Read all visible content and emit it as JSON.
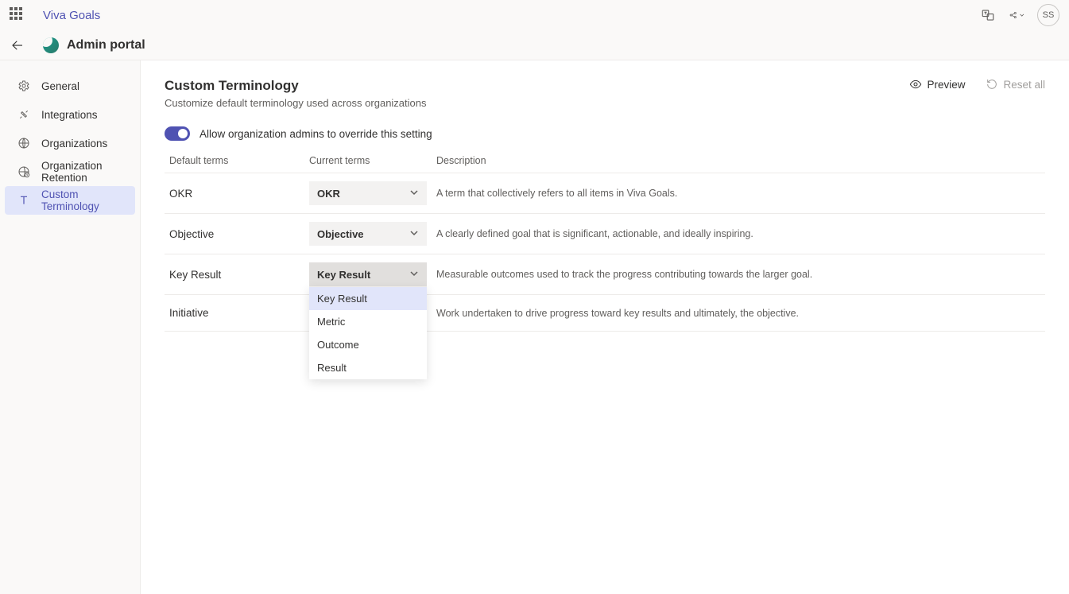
{
  "header": {
    "app_title": "Viva Goals",
    "portal_label": "Admin portal",
    "avatar_initials": "SS"
  },
  "sidebar": {
    "items": [
      {
        "label": "General"
      },
      {
        "label": "Integrations"
      },
      {
        "label": "Organizations"
      },
      {
        "label": "Organization Retention"
      },
      {
        "label": "Custom Terminology"
      }
    ]
  },
  "page": {
    "title": "Custom Terminology",
    "subtitle": "Customize default terminology used across organizations",
    "preview_label": "Preview",
    "reset_label": "Reset all"
  },
  "toggle": {
    "label": "Allow organization admins to override this setting"
  },
  "table": {
    "headers": {
      "default_terms": "Default terms",
      "current_terms": "Current terms",
      "description": "Description"
    },
    "rows": [
      {
        "default": "OKR",
        "current": "OKR",
        "description": "A term that collectively refers to all items in Viva Goals."
      },
      {
        "default": "Objective",
        "current": "Objective",
        "description": "A clearly defined goal that is significant, actionable, and ideally inspiring."
      },
      {
        "default": "Key Result",
        "current": "Key Result",
        "description": "Measurable outcomes used to track the progress contributing towards the larger goal."
      },
      {
        "default": "Initiative",
        "current": "",
        "description": "Work undertaken to drive progress toward key results and ultimately, the objective."
      }
    ],
    "dropdown_options": [
      "Key Result",
      "Metric",
      "Outcome",
      "Result"
    ]
  }
}
